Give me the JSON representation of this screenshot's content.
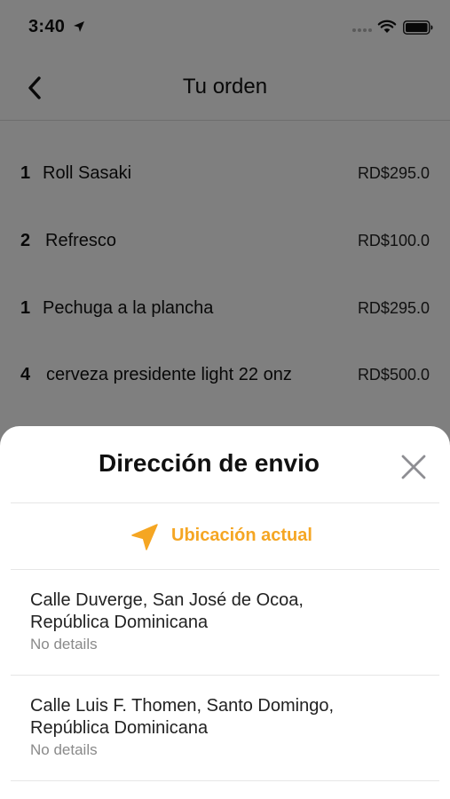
{
  "status_bar": {
    "time": "3:40"
  },
  "nav": {
    "title": "Tu orden"
  },
  "order": {
    "items": [
      {
        "qty": "1",
        "name": "Roll Sasaki",
        "price": "RD$295.0"
      },
      {
        "qty": "2",
        "name": "Refresco",
        "price": "RD$100.0"
      },
      {
        "qty": "1",
        "name": "Pechuga a la plancha",
        "price": "RD$295.0"
      },
      {
        "qty": "4",
        "name": "cerveza presidente light 22 onz",
        "price": "RD$500.0"
      }
    ]
  },
  "sheet": {
    "title": "Dirección de envio",
    "current_location_label": "Ubicación actual",
    "addresses": [
      {
        "line1": "Calle Duverge, San José de Ocoa,",
        "line2": "República Dominicana",
        "details": "No details"
      },
      {
        "line1": "Calle Luis F. Thomen, Santo Domingo,",
        "line2": "República Dominicana",
        "details": "No details"
      }
    ]
  },
  "colors": {
    "accent": "#f5a623",
    "overlay": "rgba(0,0,0,0.5)"
  },
  "icons": [
    "location-arrow-icon",
    "wifi-icon",
    "battery-icon",
    "back-chevron-icon",
    "close-icon",
    "navigation-arrow-icon"
  ]
}
